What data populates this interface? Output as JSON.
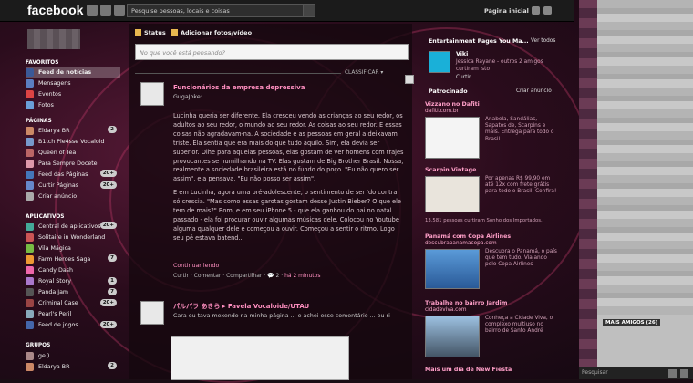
{
  "header": {
    "logo": "facebook",
    "search_placeholder": "Pesquise pessoas, locais e coisas",
    "home": "Página inicial"
  },
  "left": {
    "sections": {
      "favorites": "FAVORITOS",
      "pages": "PÁGINAS",
      "apps": "APLICATIVOS",
      "groups": "GRUPOS"
    },
    "favorites": [
      {
        "label": "Feed de notícias",
        "color": "#3b5998",
        "selected": true
      },
      {
        "label": "Mensagens",
        "color": "#5b7fc2"
      },
      {
        "label": "Eventos",
        "color": "#d44"
      },
      {
        "label": "Fotos",
        "color": "#6a9fd8"
      }
    ],
    "pages": [
      {
        "label": "Eldarya BR",
        "badge": "2",
        "color": "#c86"
      },
      {
        "label": "B1tch Ple4sse Vocaloid",
        "color": "#79c"
      },
      {
        "label": "Queen of Tea",
        "color": "#b66"
      },
      {
        "label": "Para Sempre Docete",
        "color": "#d9a"
      },
      {
        "label": "Feed das Páginas",
        "badge": "20+",
        "color": "#47b"
      },
      {
        "label": "Curtir Páginas",
        "badge": "20+",
        "color": "#68c"
      },
      {
        "label": "Criar anúncio",
        "color": "#aaa"
      }
    ],
    "apps": [
      {
        "label": "Central de aplicativos",
        "badge": "20+",
        "color": "#4a9"
      },
      {
        "label": "Solitaire in Wonderland",
        "color": "#c55"
      },
      {
        "label": "Vila Mágica",
        "color": "#7b4"
      },
      {
        "label": "Farm Heroes Saga",
        "badge": "7",
        "color": "#e93"
      },
      {
        "label": "Candy Dash",
        "color": "#e6a"
      },
      {
        "label": "Royal Story",
        "badge": "1",
        "color": "#a7c"
      },
      {
        "label": "Panda Jam",
        "badge": "7",
        "color": "#555"
      },
      {
        "label": "Criminal Case",
        "badge": "20+",
        "color": "#944"
      },
      {
        "label": "Pearl's Peril",
        "color": "#8ab"
      },
      {
        "label": "Feed de jogos",
        "badge": "20+",
        "color": "#46a"
      }
    ],
    "groups": [
      {
        "label": "ge )",
        "color": "#a88"
      },
      {
        "label": "Eldarya BR",
        "badge": "2",
        "color": "#c86"
      }
    ]
  },
  "composer": {
    "status": "Status",
    "photo": "Adicionar fotos/vídeo",
    "placeholder": "No que você está pensando?",
    "classify": "CLASSIFICAR ▾"
  },
  "posts": [
    {
      "title": "Funcionários da empresa depressiva",
      "author": "GugaJoke:",
      "body1": "Lucinha queria ser diferente. Ela cresceu vendo as crianças ao seu redor, os adultos ao seu redor, o mundo ao seu redor. As coisas ao seu redor. E essas coisas não agradavam-na. A sociedade e as pessoas em geral a deixavam triste. Ela sentia que era mais do que tudo aquilo. Sim, ela devia ser superior. Olhe para aquelas pessoas, elas gostam de ver homens com trajes provocantes se humilhando na TV. Elas gostam de Big Brother Brasil. Nossa, realmente a sociedade brasileira está no fundo do poço. \"Eu não quero ser assim\", ela pensava, \"Eu não posso ser assim\".",
      "body2": "E em Lucinha, agora uma pré-adolescente, o sentimento de ser 'do contra' só crescia. \"Mas como essas garotas gostam desse Justin Bieber? O que ele tem de mais?\" Bom, e em seu iPhone 5 - que ela ganhou do pai no natal passado - ela foi procurar ouvir algumas músicas dele. Colocou no Youtube alguma qualquer dele e começou a ouvir. Começou a sentir o ritmo. Logo seu pé estava batend...",
      "more": "Continuar lendo",
      "actions": "Curtir · Comentar · Compartilhar · ",
      "comments": "2",
      "time": "há 2 minutos"
    },
    {
      "title": "パルパラ あきら ▸ Favela Vocaloide/UTAU",
      "body": "Cara eu tava mexendo na minha página ... e achei esse comentário ... eu ri"
    }
  ],
  "right": {
    "ent_title": "Entertainment Pages You Ma...",
    "see_all": "Ver todos",
    "viki": {
      "name": "Viki",
      "friends": "Jessica Rayane - outros 2 amigos",
      "likes": "curtiram isto",
      "like": "Curtir"
    },
    "sponsored": "Patrocinado",
    "create_ad": "Criar anúncio",
    "ads": [
      {
        "title": "Vizzano no Dafiti",
        "url": "dafiti.com.br",
        "desc": "Anabela, Sandálias, Sapatos de, Scarpins e mais. Entrega para todo o Brasil"
      },
      {
        "title": "Scarpin Vintage",
        "url": "",
        "desc": "Por apenas R$ 99,90 em até 12x com frete grátis para todo o Brasil. Confira!",
        "footer": "13.581 pessoas curtiram Sonho dos Importados."
      },
      {
        "title": "Panamá com Copa Airlines",
        "url": "descubrapanamacopa.com",
        "desc": "Descubra o Panamá, o país que tem tudo. Viajando pelo Copa Airlines"
      },
      {
        "title": "Trabalhe no bairro Jardim",
        "url": "cidadeviva.com",
        "desc": "Conheça a Cidade Viva, o complexo multiuso no bairro de Santo André"
      },
      {
        "title": "Mais um dia de New Fiesta",
        "url": "",
        "desc": ""
      }
    ]
  },
  "chat": {
    "more_friends": "MAIS AMIGOS (26)",
    "search": "Pesquisar"
  },
  "colors": {
    "topbar": "#1b1b1b",
    "link_pink": "#ff8fc0"
  }
}
